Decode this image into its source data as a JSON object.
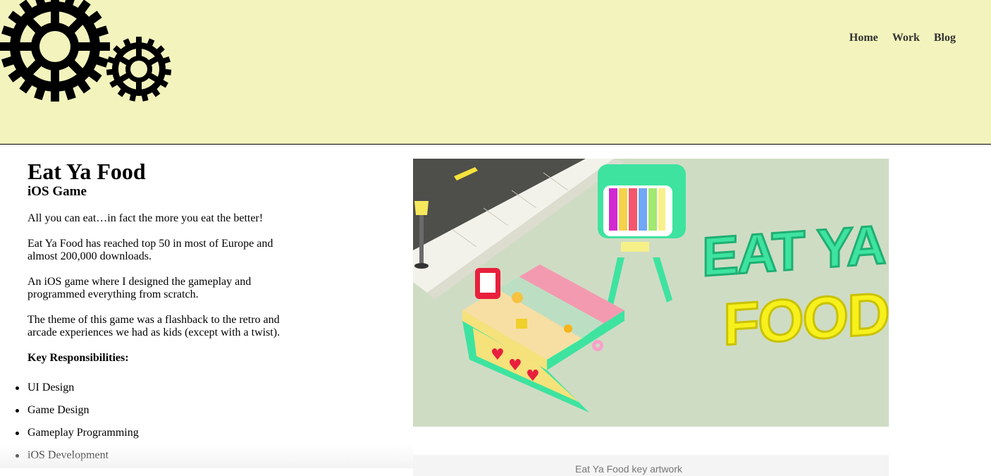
{
  "header": {
    "logo_icon": "gears-icon",
    "background_color": "#f3f3bd"
  },
  "nav": {
    "items": [
      {
        "label": "Home"
      },
      {
        "label": "Work"
      },
      {
        "label": "Blog"
      }
    ]
  },
  "project": {
    "title": "Eat Ya Food",
    "subtitle": "iOS Game",
    "paragraphs": [
      "All you can eat…in fact the more you eat the better!",
      "Eat Ya Food has reached top 50 in most of Europe and almost 200,000 downloads.",
      "An iOS game where I designed the gameplay and programmed everything from scratch.",
      "The theme of this game was a flashback to the retro and arcade experiences we had as kids (except with a twist)."
    ],
    "responsibilities_label": "Key Responsibilities:",
    "responsibilities": [
      "UI Design",
      "Game Design",
      "Gameplay Programming",
      "iOS Development"
    ]
  },
  "hero": {
    "logo_line1": "EAT YA",
    "logo_line2": "FOOD",
    "caption": "Eat Ya Food key artwork"
  },
  "colors": {
    "header_bg": "#f3f3bd",
    "hero_bg": "#cfdcc4",
    "accent_green": "#3ee3a0",
    "accent_yellow": "#f7f01c"
  }
}
